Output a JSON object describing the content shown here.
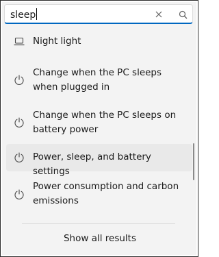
{
  "search": {
    "query": "sleep"
  },
  "results": [
    {
      "label": "Night light",
      "icon": "laptop-icon"
    },
    {
      "label": "Change when the PC sleeps when plugged in",
      "icon": "power-icon"
    },
    {
      "label": "Change when the PC sleeps on battery power",
      "icon": "power-icon"
    },
    {
      "label": "Power, sleep, and battery settings",
      "icon": "power-icon",
      "selected": true
    },
    {
      "label": "Power consumption and carbon emissions",
      "icon": "power-icon"
    }
  ],
  "footer": {
    "show_all_label": "Show all results"
  },
  "colors": {
    "accent": "#0067c0",
    "panel_bg": "#f3f3f3",
    "selected_bg": "#e9e9e9"
  }
}
